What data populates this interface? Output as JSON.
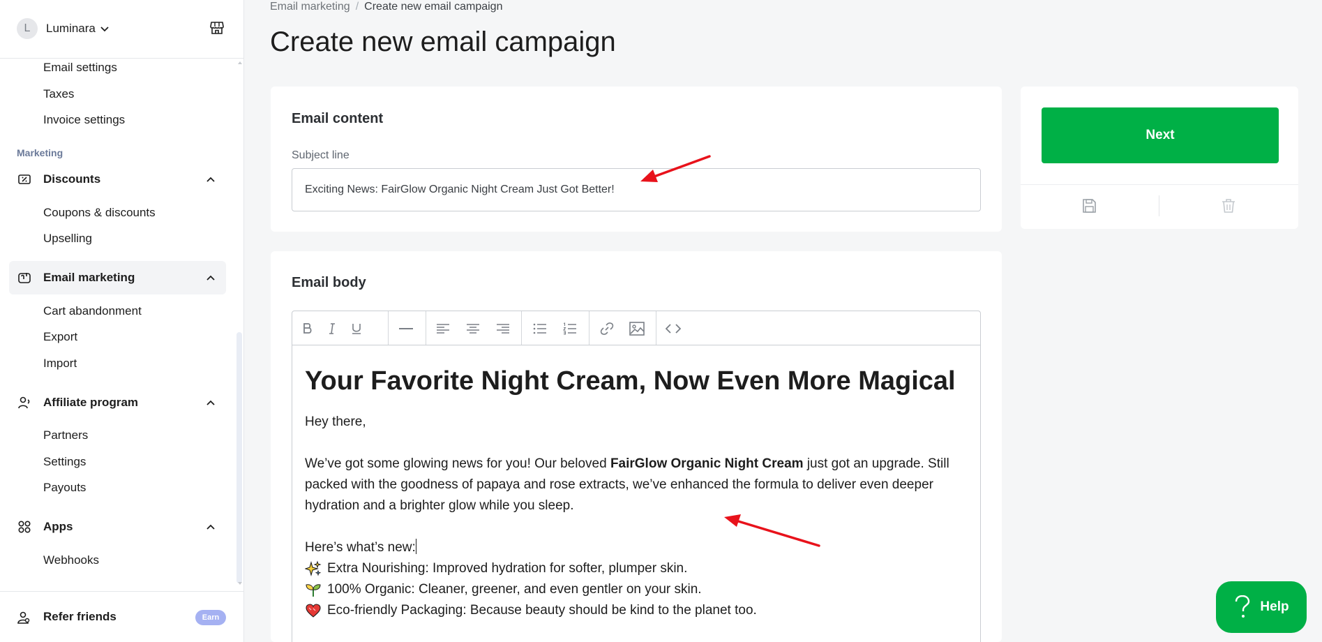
{
  "store": {
    "avatar_letter": "L",
    "name": "Luminara"
  },
  "sidebar": {
    "top_items": [
      "Email settings",
      "Taxes",
      "Invoice settings"
    ],
    "section_label": "Marketing",
    "groups": [
      {
        "label": "Discounts",
        "items": [
          "Coupons & discounts",
          "Upselling"
        ]
      },
      {
        "label": "Email marketing",
        "items": [
          "Cart abandonment",
          "Export",
          "Import"
        ]
      },
      {
        "label": "Affiliate program",
        "items": [
          "Partners",
          "Settings",
          "Payouts"
        ]
      },
      {
        "label": "Apps",
        "items": [
          "Webhooks"
        ]
      }
    ],
    "refer_label": "Refer friends",
    "earn_badge": "Earn"
  },
  "breadcrumb": {
    "parent": "Email marketing",
    "separator": "/",
    "current": "Create new email campaign"
  },
  "page_title": "Create new email campaign",
  "email_content": {
    "heading": "Email content",
    "subject_label": "Subject line",
    "subject_value": "Exciting News: FairGlow Organic Night Cream Just Got Better!"
  },
  "email_body": {
    "heading": "Email body",
    "toolbar": [
      "bold-icon",
      "italic-icon",
      "underline-icon",
      "horizontal-rule-icon",
      "align-left-icon",
      "align-center-icon",
      "align-right-icon",
      "bullet-list-icon",
      "numbered-list-icon",
      "link-icon",
      "image-icon",
      "code-icon"
    ],
    "title": "Your Favorite Night Cream, Now Even More Magical",
    "greeting": "Hey there,",
    "intro_before": "We’ve got some glowing news for you! Our beloved ",
    "intro_bold": "FairGlow Organic Night Cream",
    "intro_after": " just got an upgrade. Still packed with the goodness of papaya and rose extracts, we’ve enhanced the formula to deliver even deeper hydration and a brighter glow while you sleep.",
    "whats_new": "Here’s what’s new:",
    "bullets": [
      {
        "icon": "sparkles-icon",
        "text": "Extra Nourishing: Improved hydration for softer, plumper skin."
      },
      {
        "icon": "seedling-icon",
        "text": "100% Organic: Cleaner, greener, and even gentler on your skin."
      },
      {
        "icon": "heart-icon",
        "text": "Eco-friendly Packaging: Because beauty should be kind to the planet too."
      }
    ]
  },
  "actions": {
    "next_label": "Next",
    "help_label": "Help"
  },
  "colors": {
    "primary_green": "#00b046",
    "annotation_red": "#e8121b",
    "earn_badge": "#a5b1f2"
  }
}
